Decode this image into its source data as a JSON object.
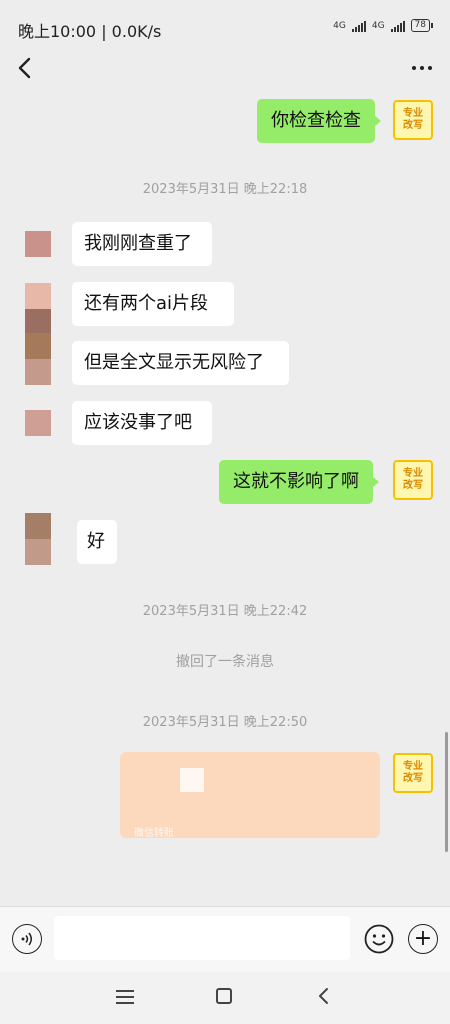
{
  "status_bar": {
    "time_speed": "晚上10:00 | 0.0K/s",
    "network_1": "4G",
    "network_2": "4G",
    "battery": "78"
  },
  "messages": [
    {
      "side": "right",
      "text": "你检查检查"
    },
    {
      "type": "time",
      "text": "2023年5月31日 晚上22:18"
    },
    {
      "side": "left",
      "text": "我刚刚查重了"
    },
    {
      "side": "left",
      "text": "还有两个ai片段"
    },
    {
      "side": "left",
      "text": "但是全文显示无风险了"
    },
    {
      "side": "left",
      "text": "应该没事了吧"
    },
    {
      "side": "right",
      "text": "这就不影响了啊"
    },
    {
      "side": "left",
      "text": "好"
    },
    {
      "type": "time",
      "text": "2023年5月31日 晚上22:42"
    },
    {
      "type": "recall",
      "text": "撤回了一条消息"
    },
    {
      "type": "time",
      "text": "2023年5月31日 晚上22:50"
    },
    {
      "side": "right",
      "type": "card",
      "label": "微信转账"
    }
  ],
  "self_avatar": {
    "line1": "专业",
    "line2": "改写"
  },
  "colors": {
    "self_bubble": "#95ec69",
    "other_bubble": "#ffffff",
    "background": "#ededed",
    "card": "#fcd9bd"
  },
  "icons": {
    "back": "chevron-left-icon",
    "more": "more-dots-icon",
    "voice": "voice-icon",
    "emoji": "emoji-icon",
    "plus": "plus-icon"
  }
}
